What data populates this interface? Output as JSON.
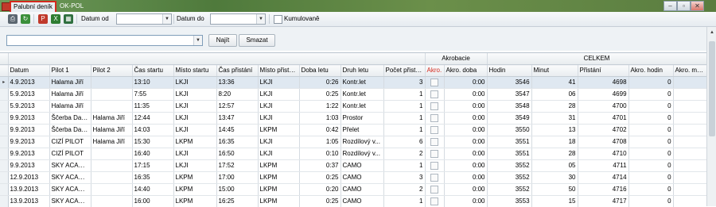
{
  "window": {
    "active_tab": "Palubní deník",
    "document_title": "OK-POL",
    "buttons": {
      "minimize": "–",
      "restore": "▫",
      "close": "✕"
    }
  },
  "toolbar": {
    "date_from_label": "Datum od",
    "date_to_label": "Datum do",
    "cumulative_label": "Kumulovaně",
    "icons": [
      "print-icon",
      "refresh-icon",
      "pdf-icon",
      "excel-icon",
      "export-icon"
    ],
    "icon_colors": {
      "pdf": "#c0392b",
      "excel": "#2e7d32",
      "refresh": "#3a8f3a",
      "print": "#5b6670",
      "export": "#2f6f3f"
    }
  },
  "search": {
    "value": "",
    "find_label": "Najít",
    "clear_label": "Smazat"
  },
  "grid": {
    "group_headers": {
      "akrobacie": "Akrobacie",
      "celkem": "CELKEM"
    },
    "columns": [
      "Datum",
      "Pilot 1",
      "Pilot 2",
      "Čas startu",
      "Místo startu",
      "Čas přistání",
      "Místo přistání",
      "Doba letu",
      "Druh letu",
      "Počet přistání",
      "Akro.",
      "Akro. doba",
      "Hodin",
      "Minut",
      "Přistání",
      "Akro. hodin",
      "Akro. minut"
    ],
    "rows": [
      [
        "4.9.2013",
        "Halama Jiří",
        "",
        "13:10",
        "LKJI",
        "13:36",
        "LKJI",
        "0:26",
        "Kontr.let",
        "3",
        "",
        "0:00",
        "3546",
        "41",
        "4698",
        "0",
        ""
      ],
      [
        "5.9.2013",
        "Halama Jiří",
        "",
        "7:55",
        "LKJI",
        "8:20",
        "LKJI",
        "0:25",
        "Kontr.let",
        "1",
        "",
        "0:00",
        "3547",
        "06",
        "4699",
        "0",
        ""
      ],
      [
        "5.9.2013",
        "Halama Jiří",
        "",
        "11:35",
        "LKJI",
        "12:57",
        "LKJI",
        "1:22",
        "Kontr.let",
        "1",
        "",
        "0:00",
        "3548",
        "28",
        "4700",
        "0",
        ""
      ],
      [
        "9.9.2013",
        "Ščerba David",
        "Halama Jiří",
        "12:44",
        "LKJI",
        "13:47",
        "LKJI",
        "1:03",
        "Prostor",
        "1",
        "",
        "0:00",
        "3549",
        "31",
        "4701",
        "0",
        ""
      ],
      [
        "9.9.2013",
        "Ščerba David",
        "Halama Jiří",
        "14:03",
        "LKJI",
        "14:45",
        "LKPM",
        "0:42",
        "Přelet",
        "1",
        "",
        "0:00",
        "3550",
        "13",
        "4702",
        "0",
        ""
      ],
      [
        "9.9.2013",
        "CIZÍ PILOT",
        "Halama Jiří",
        "15:30",
        "LKPM",
        "16:35",
        "LKJI",
        "1:05",
        "Rozdílový v...",
        "6",
        "",
        "0:00",
        "3551",
        "18",
        "4708",
        "0",
        ""
      ],
      [
        "9.9.2013",
        "CIZÍ PILOT",
        "",
        "16:40",
        "LKJI",
        "16:50",
        "LKJI",
        "0:10",
        "Rozdílový v...",
        "2",
        "",
        "0:00",
        "3551",
        "28",
        "4710",
        "0",
        ""
      ],
      [
        "9.9.2013",
        "SKY ACADE...",
        "",
        "17:15",
        "LKJI",
        "17:52",
        "LKPM",
        "0:37",
        "CAMO",
        "1",
        "",
        "0:00",
        "3552",
        "05",
        "4711",
        "0",
        ""
      ],
      [
        "12.9.2013",
        "SKY ACADE...",
        "",
        "16:35",
        "LKPM",
        "17:00",
        "LKPM",
        "0:25",
        "CAMO",
        "3",
        "",
        "0:00",
        "3552",
        "30",
        "4714",
        "0",
        ""
      ],
      [
        "13.9.2013",
        "SKY ACADE...",
        "",
        "14:40",
        "LKPM",
        "15:00",
        "LKPM",
        "0:20",
        "CAMO",
        "2",
        "",
        "0:00",
        "3552",
        "50",
        "4716",
        "0",
        ""
      ],
      [
        "13.9.2013",
        "SKY ACADE...",
        "",
        "16:00",
        "LKPM",
        "16:25",
        "LKPM",
        "0:25",
        "CAMO",
        "1",
        "",
        "0:00",
        "3553",
        "15",
        "4717",
        "0",
        ""
      ]
    ]
  }
}
